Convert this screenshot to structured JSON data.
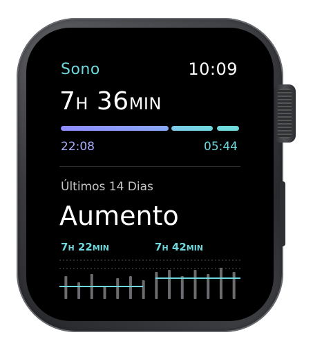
{
  "device": {
    "crown": "digital-crown",
    "side_button": "side-button"
  },
  "watch_face": {
    "app_title": "Sono",
    "clock": "10:09",
    "sleep": {
      "duration_hours": "7",
      "duration_hours_unit": "H",
      "duration_minutes": "36",
      "duration_minutes_unit": "MIN",
      "bed_time": "22:08",
      "wake_time": "05:44"
    },
    "period_label": "Últimos 14 Dias",
    "trend": "Aumento",
    "previous_average": {
      "hours": "7",
      "hours_unit": "H",
      "minutes": "22",
      "minutes_unit": "MIN"
    },
    "recent_average": {
      "hours": "7",
      "hours_unit": "H",
      "minutes": "42",
      "minutes_unit": "MIN"
    },
    "colors": {
      "accent": "#6fd8dc",
      "bar_start": "#8e8cff",
      "bar_end": "#6fd8dc",
      "bar_muted": "#6c6c70"
    },
    "trend_chart": {
      "days": 14,
      "previous_average_fraction": 0.3,
      "recent_average_fraction": 0.5,
      "bars": [
        0.55,
        0.4,
        0.6,
        0.3,
        0.5,
        0.55,
        0.45,
        0.65,
        0.7,
        0.55,
        0.7,
        0.6,
        0.75,
        0.65
      ]
    }
  }
}
